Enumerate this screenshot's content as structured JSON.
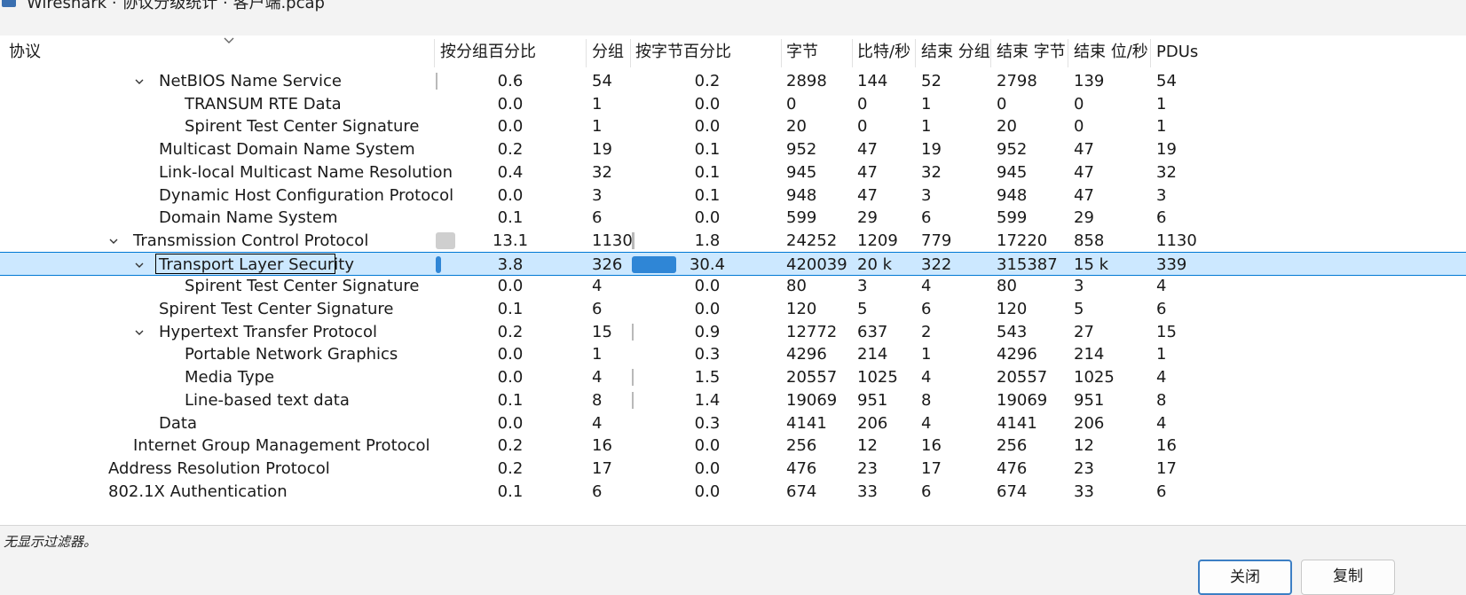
{
  "window": {
    "title": "Wireshark · 协议分级统计 · 客户端.pcap"
  },
  "columns": [
    "协议",
    "按分组百分比",
    "分组",
    "按字节百分比",
    "字节",
    "比特/秒",
    "结束 分组",
    "结束 字节",
    "结束 位/秒",
    "PDUs"
  ],
  "rows": [
    {
      "name": "NetBIOS Name Service",
      "indent": 2,
      "expanded": true,
      "pkt_pct": "0.6",
      "packets": "54",
      "byte_pct": "0.2",
      "bytes": "2898",
      "bps": "144",
      "end_pkts": "52",
      "end_bytes": "2798",
      "end_bps": "139",
      "pdus": "54"
    },
    {
      "name": "TRANSUM RTE Data",
      "indent": 3,
      "pkt_pct": "0.0",
      "packets": "1",
      "byte_pct": "0.0",
      "bytes": "0",
      "bps": "0",
      "end_pkts": "1",
      "end_bytes": "0",
      "end_bps": "0",
      "pdus": "1"
    },
    {
      "name": "Spirent Test Center Signature",
      "indent": 3,
      "pkt_pct": "0.0",
      "packets": "1",
      "byte_pct": "0.0",
      "bytes": "20",
      "bps": "0",
      "end_pkts": "1",
      "end_bytes": "20",
      "end_bps": "0",
      "pdus": "1"
    },
    {
      "name": "Multicast Domain Name System",
      "indent": 2,
      "pkt_pct": "0.2",
      "packets": "19",
      "byte_pct": "0.1",
      "bytes": "952",
      "bps": "47",
      "end_pkts": "19",
      "end_bytes": "952",
      "end_bps": "47",
      "pdus": "19"
    },
    {
      "name": "Link-local Multicast Name Resolution",
      "indent": 2,
      "pkt_pct": "0.4",
      "packets": "32",
      "byte_pct": "0.1",
      "bytes": "945",
      "bps": "47",
      "end_pkts": "32",
      "end_bytes": "945",
      "end_bps": "47",
      "pdus": "32"
    },
    {
      "name": "Dynamic Host Configuration Protocol",
      "indent": 2,
      "pkt_pct": "0.0",
      "packets": "3",
      "byte_pct": "0.1",
      "bytes": "948",
      "bps": "47",
      "end_pkts": "3",
      "end_bytes": "948",
      "end_bps": "47",
      "pdus": "3"
    },
    {
      "name": "Domain Name System",
      "indent": 2,
      "pkt_pct": "0.1",
      "packets": "6",
      "byte_pct": "0.0",
      "bytes": "599",
      "bps": "29",
      "end_pkts": "6",
      "end_bytes": "599",
      "end_bps": "29",
      "pdus": "6"
    },
    {
      "name": "Transmission Control Protocol",
      "indent": 1,
      "expanded": true,
      "pkt_pct": "13.1",
      "packets": "1130",
      "byte_pct": "1.8",
      "bytes": "24252",
      "bps": "1209",
      "end_pkts": "779",
      "end_bytes": "17220",
      "end_bps": "858",
      "pdus": "1130"
    },
    {
      "name": "Transport Layer Security",
      "indent": 2,
      "expanded": true,
      "selected": true,
      "pkt_pct": "3.8",
      "packets": "326",
      "byte_pct": "30.4",
      "bytes": "420039",
      "bps": "20 k",
      "end_pkts": "322",
      "end_bytes": "315387",
      "end_bps": "15 k",
      "pdus": "339"
    },
    {
      "name": "Spirent Test Center Signature",
      "indent": 3,
      "pkt_pct": "0.0",
      "packets": "4",
      "byte_pct": "0.0",
      "bytes": "80",
      "bps": "3",
      "end_pkts": "4",
      "end_bytes": "80",
      "end_bps": "3",
      "pdus": "4"
    },
    {
      "name": "Spirent Test Center Signature",
      "indent": 2,
      "pkt_pct": "0.1",
      "packets": "6",
      "byte_pct": "0.0",
      "bytes": "120",
      "bps": "5",
      "end_pkts": "6",
      "end_bytes": "120",
      "end_bps": "5",
      "pdus": "6"
    },
    {
      "name": "Hypertext Transfer Protocol",
      "indent": 2,
      "expanded": true,
      "pkt_pct": "0.2",
      "packets": "15",
      "byte_pct": "0.9",
      "bytes": "12772",
      "bps": "637",
      "end_pkts": "2",
      "end_bytes": "543",
      "end_bps": "27",
      "pdus": "15"
    },
    {
      "name": "Portable Network Graphics",
      "indent": 3,
      "pkt_pct": "0.0",
      "packets": "1",
      "byte_pct": "0.3",
      "bytes": "4296",
      "bps": "214",
      "end_pkts": "1",
      "end_bytes": "4296",
      "end_bps": "214",
      "pdus": "1"
    },
    {
      "name": "Media Type",
      "indent": 3,
      "pkt_pct": "0.0",
      "packets": "4",
      "byte_pct": "1.5",
      "bytes": "20557",
      "bps": "1025",
      "end_pkts": "4",
      "end_bytes": "20557",
      "end_bps": "1025",
      "pdus": "4"
    },
    {
      "name": "Line-based text data",
      "indent": 3,
      "pkt_pct": "0.1",
      "packets": "8",
      "byte_pct": "1.4",
      "bytes": "19069",
      "bps": "951",
      "end_pkts": "8",
      "end_bytes": "19069",
      "end_bps": "951",
      "pdus": "8"
    },
    {
      "name": "Data",
      "indent": 2,
      "pkt_pct": "0.0",
      "packets": "4",
      "byte_pct": "0.3",
      "bytes": "4141",
      "bps": "206",
      "end_pkts": "4",
      "end_bytes": "4141",
      "end_bps": "206",
      "pdus": "4"
    },
    {
      "name": "Internet Group Management Protocol",
      "indent": 1,
      "pkt_pct": "0.2",
      "packets": "16",
      "byte_pct": "0.0",
      "bytes": "256",
      "bps": "12",
      "end_pkts": "16",
      "end_bytes": "256",
      "end_bps": "12",
      "pdus": "16"
    },
    {
      "name": "Address Resolution Protocol",
      "indent": 0,
      "pkt_pct": "0.2",
      "packets": "17",
      "byte_pct": "0.0",
      "bytes": "476",
      "bps": "23",
      "end_pkts": "17",
      "end_bytes": "476",
      "end_bps": "23",
      "pdus": "17"
    },
    {
      "name": "802.1X Authentication",
      "indent": 0,
      "pkt_pct": "0.1",
      "packets": "6",
      "byte_pct": "0.0",
      "bytes": "674",
      "bps": "33",
      "end_pkts": "6",
      "end_bytes": "674",
      "end_bps": "33",
      "pdus": "6"
    }
  ],
  "status": {
    "filter_text": "无显示过滤器。"
  },
  "buttons": {
    "close": "关闭",
    "copy": "复制"
  },
  "colors": {
    "selection": "#cce8ff",
    "selection_border": "#0078d4",
    "bar_blue": "#2f86d6",
    "bar_gray": "#cfcfcf"
  },
  "icons": {
    "expanded": "chevron-down-icon",
    "sort": "sort-desc-icon"
  }
}
